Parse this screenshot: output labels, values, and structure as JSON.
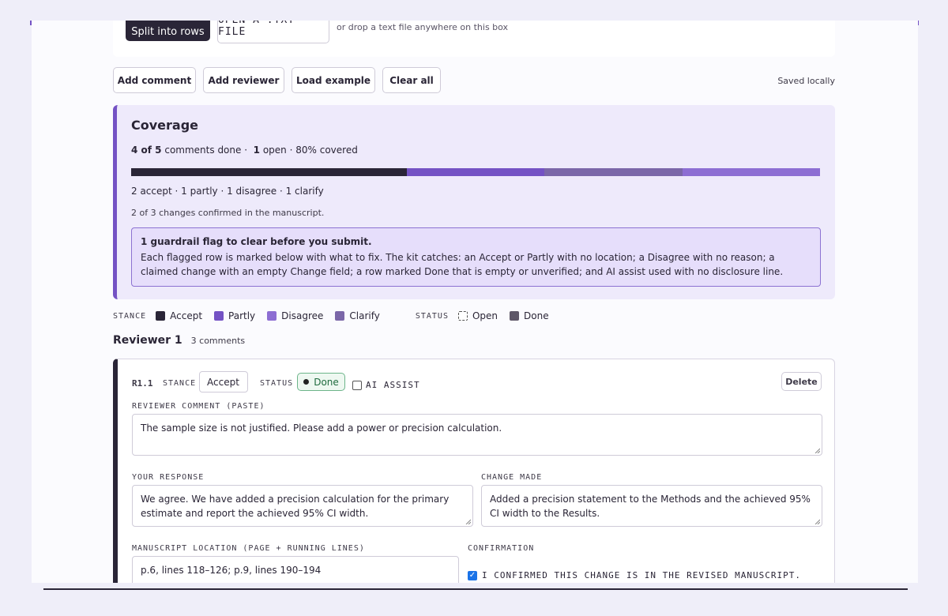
{
  "toolbar_top": {
    "split_label": "Split into rows",
    "open_label": "OPEN A .TXT FILE",
    "drop_hint": "or drop a text file anywhere on this box"
  },
  "actions": {
    "add_comment": "Add comment",
    "add_reviewer": "Add reviewer",
    "load_example": "Load example",
    "clear_all": "Clear all",
    "saved_status": "Saved locally"
  },
  "coverage": {
    "title": "Coverage",
    "done_count": "4 of 5",
    "done_suffix": "comments done ·",
    "open_count": "1",
    "open_suffix": "open · 80% covered",
    "bar": [
      {
        "stance": "accept",
        "fraction": 0.4,
        "color": "#2a2537"
      },
      {
        "stance": "partly",
        "fraction": 0.2,
        "color": "#7452c4"
      },
      {
        "stance": "disagree",
        "fraction": 0.2,
        "color": "#7b67a8"
      },
      {
        "stance": "clarify",
        "fraction": 0.2,
        "color": "#8d6ed3"
      }
    ],
    "counts": "2 accept · 1 partly · 1 disagree · 1 clarify",
    "confirmed": "2 of 3 changes confirmed in the manuscript.",
    "guard_title": "1 guardrail flag to clear before you submit.",
    "guard_text": "Each flagged row is marked below with what to fix. The kit catches: an Accept or Partly with no location; a Disagree with no reason; a claimed change with an empty Change field; a row marked Done that is empty or unverified; and AI assist used with no disclosure line."
  },
  "legend": {
    "stance_label": "STANCE",
    "status_label": "STATUS",
    "stances": [
      {
        "name": "Accept",
        "color": "#2a2537"
      },
      {
        "name": "Partly",
        "color": "#7452c4"
      },
      {
        "name": "Disagree",
        "color": "#8d6ed3"
      },
      {
        "name": "Clarify",
        "color": "#7b67a8"
      }
    ],
    "statuses": [
      {
        "name": "Open",
        "color": "open-dashed"
      },
      {
        "name": "Done",
        "color": "#5f5868"
      }
    ]
  },
  "reviewer": {
    "title": "Reviewer 1",
    "count": "3 comments"
  },
  "comment": {
    "id": "R1.1",
    "stance_label": "STANCE",
    "stance_value": "Accept",
    "status_label": "STATUS",
    "status_value": "Done",
    "ai_label": "AI ASSIST",
    "delete_label": "Delete",
    "reviewer_comment_label": "REVIEWER COMMENT (PASTE)",
    "reviewer_comment": "The sample size is not justified. Please add a power or precision calculation.",
    "response_label": "YOUR RESPONSE",
    "response": "We agree. We have added a precision calculation for the primary estimate and report the achieved 95% CI width.",
    "change_label": "CHANGE MADE",
    "change": "Added a precision statement to the Methods and the achieved 95% CI width to the Results.",
    "location_label": "MANUSCRIPT LOCATION (PAGE + RUNNING LINES)",
    "location": "p.6, lines 118–126; p.9, lines 190–194",
    "confirmation_label": "CONFIRMATION",
    "confirmation_text": "I CONFIRMED THIS CHANGE IS IN THE REVISED MANUSCRIPT."
  }
}
